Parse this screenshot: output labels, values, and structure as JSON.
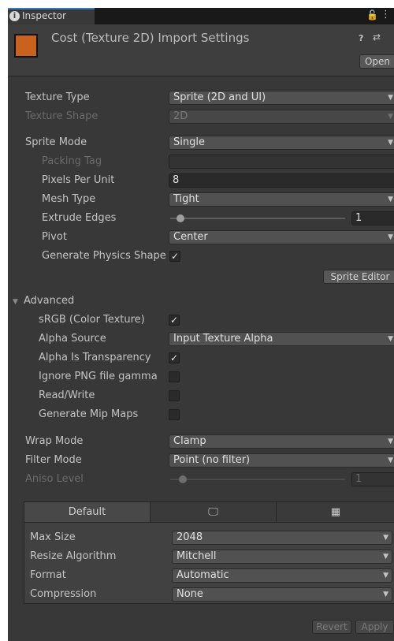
{
  "tab": {
    "label": "Inspector",
    "icon": "i"
  },
  "header": {
    "title": "Cost (Texture 2D) Import Settings",
    "help_glyph": "?",
    "preset_glyph": "⇄",
    "open_label": "Open"
  },
  "texture_type": {
    "label": "Texture Type",
    "value": "Sprite (2D and UI)"
  },
  "texture_shape": {
    "label": "Texture Shape",
    "value": "2D"
  },
  "sprite_mode": {
    "label": "Sprite Mode",
    "value": "Single"
  },
  "packing_tag": {
    "label": "Packing Tag",
    "value": ""
  },
  "pixels_per_unit": {
    "label": "Pixels Per Unit",
    "value": "8"
  },
  "mesh_type": {
    "label": "Mesh Type",
    "value": "Tight"
  },
  "extrude_edges": {
    "label": "Extrude Edges",
    "value": "1"
  },
  "pivot": {
    "label": "Pivot",
    "value": "Center"
  },
  "generate_physics_shape": {
    "label": "Generate Physics Shape",
    "checked": true
  },
  "sprite_editor_label": "Sprite Editor",
  "advanced": {
    "label": "Advanced",
    "srgb": {
      "label": "sRGB (Color Texture)",
      "checked": true
    },
    "alpha_source": {
      "label": "Alpha Source",
      "value": "Input Texture Alpha"
    },
    "alpha_is_transparency": {
      "label": "Alpha Is Transparency",
      "checked": true
    },
    "ignore_png_gamma": {
      "label": "Ignore PNG file gamma",
      "checked": false
    },
    "read_write": {
      "label": "Read/Write",
      "checked": false
    },
    "generate_mip_maps": {
      "label": "Generate Mip Maps",
      "checked": false
    }
  },
  "wrap_mode": {
    "label": "Wrap Mode",
    "value": "Clamp"
  },
  "filter_mode": {
    "label": "Filter Mode",
    "value": "Point (no filter)"
  },
  "aniso_level": {
    "label": "Aniso Level",
    "value": "1"
  },
  "platform": {
    "tabs": {
      "default": "Default"
    },
    "max_size": {
      "label": "Max Size",
      "value": "2048"
    },
    "resize_algorithm": {
      "label": "Resize Algorithm",
      "value": "Mitchell"
    },
    "format": {
      "label": "Format",
      "value": "Automatic"
    },
    "compression": {
      "label": "Compression",
      "value": "None"
    }
  },
  "footer": {
    "revert_label": "Revert",
    "apply_label": "Apply"
  },
  "glyphs": {
    "check": "✓",
    "dropdown_arrow": "▼",
    "fold_open": "▼",
    "lock": "🔓",
    "menu": "⋮",
    "monitor": "🖵",
    "chip": "▦"
  },
  "colors": {
    "panel_bg": "#383838",
    "accent_tab": "#3a79bb",
    "texture_thumb": "#c8621c"
  }
}
